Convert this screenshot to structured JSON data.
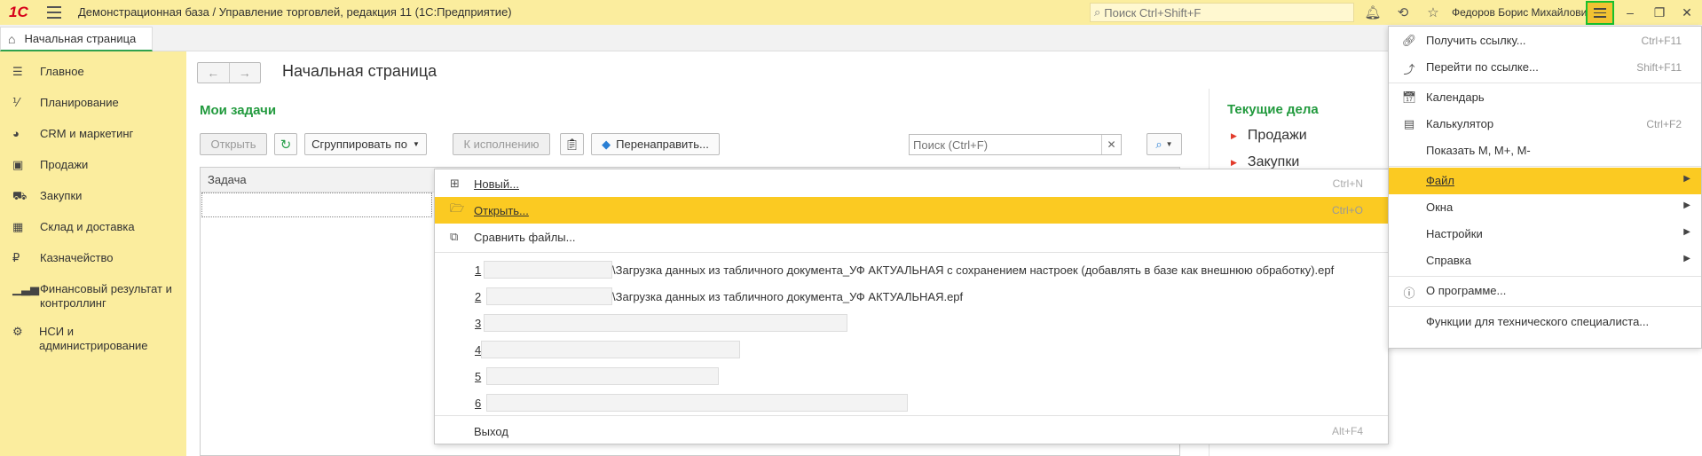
{
  "titlebar": {
    "logo": "1С",
    "title": "Демонстрационная база / Управление торговлей, редакция 11  (1С:Предприятие)",
    "search_placeholder": "Поиск Ctrl+Shift+F",
    "user": "Федоров Борис Михайлович"
  },
  "tabs": {
    "home": "Начальная страница"
  },
  "sidebar": {
    "items": [
      {
        "label": "Главное",
        "icon": "list-icon"
      },
      {
        "label": "Планирование",
        "icon": "planning-icon"
      },
      {
        "label": "CRM и маркетинг",
        "icon": "pie-icon"
      },
      {
        "label": "Продажи",
        "icon": "bag-icon"
      },
      {
        "label": "Закупки",
        "icon": "cart-icon"
      },
      {
        "label": "Склад и доставка",
        "icon": "grid-icon"
      },
      {
        "label": "Казначейство",
        "icon": "ruble-icon"
      },
      {
        "label": "Финансовый результат и контроллинг",
        "icon": "bar-chart-icon"
      },
      {
        "label": "НСИ и администрирование",
        "icon": "gear-icon"
      }
    ]
  },
  "main": {
    "page_title": "Начальная страница",
    "section_title": "Мои задачи",
    "toolbar": {
      "open": "Открыть",
      "group_by": "Сгруппировать по",
      "to_execute": "К исполнению",
      "redirect": "Перенаправить...",
      "search_placeholder": "Поиск (Ctrl+F)"
    },
    "table": {
      "col_task": "Задача"
    }
  },
  "right_panel": {
    "title": "Текущие дела",
    "items": [
      "Продажи",
      "Закупки"
    ]
  },
  "file_menu": {
    "new": {
      "label": "Новый...",
      "shortcut": "Ctrl+N"
    },
    "open": {
      "label": "Открыть...",
      "shortcut": "Ctrl+O"
    },
    "compare": {
      "label": "Сравнить файлы..."
    },
    "recent": [
      {
        "num": "1",
        "path": "\\Загрузка данных из табличного документа_УФ АКТУАЛЬНАЯ с сохранением настроек (добавлять в базе как внешнюю обработку).epf"
      },
      {
        "num": "2",
        "path": "\\Загрузка данных из табличного документа_УФ АКТУАЛЬНАЯ.epf"
      },
      {
        "num": "3",
        "path": ""
      },
      {
        "num": "4",
        "path": ""
      },
      {
        "num": "5",
        "path": ""
      },
      {
        "num": "6",
        "path": ""
      }
    ],
    "exit": {
      "label": "Выход",
      "shortcut": "Alt+F4"
    }
  },
  "main_menu": {
    "get_link": {
      "label": "Получить ссылку...",
      "shortcut": "Ctrl+F11"
    },
    "goto_link": {
      "label": "Перейти по ссылке...",
      "shortcut": "Shift+F11"
    },
    "calendar": {
      "label": "Календарь"
    },
    "calculator": {
      "label": "Калькулятор",
      "shortcut": "Ctrl+F2"
    },
    "show_m": {
      "label": "Показать M, M+, M-"
    },
    "file": {
      "label": "Файл"
    },
    "windows": {
      "label": "Окна"
    },
    "settings": {
      "label": "Настройки"
    },
    "help": {
      "label": "Справка"
    },
    "about": {
      "label": "О программе..."
    },
    "tech": {
      "label": "Функции для технического специалиста..."
    }
  },
  "colors": {
    "titlebar_bg": "#fbed9e",
    "highlight": "#fbca22",
    "accent_green": "#229a3e",
    "logo_red": "#d7001a"
  }
}
